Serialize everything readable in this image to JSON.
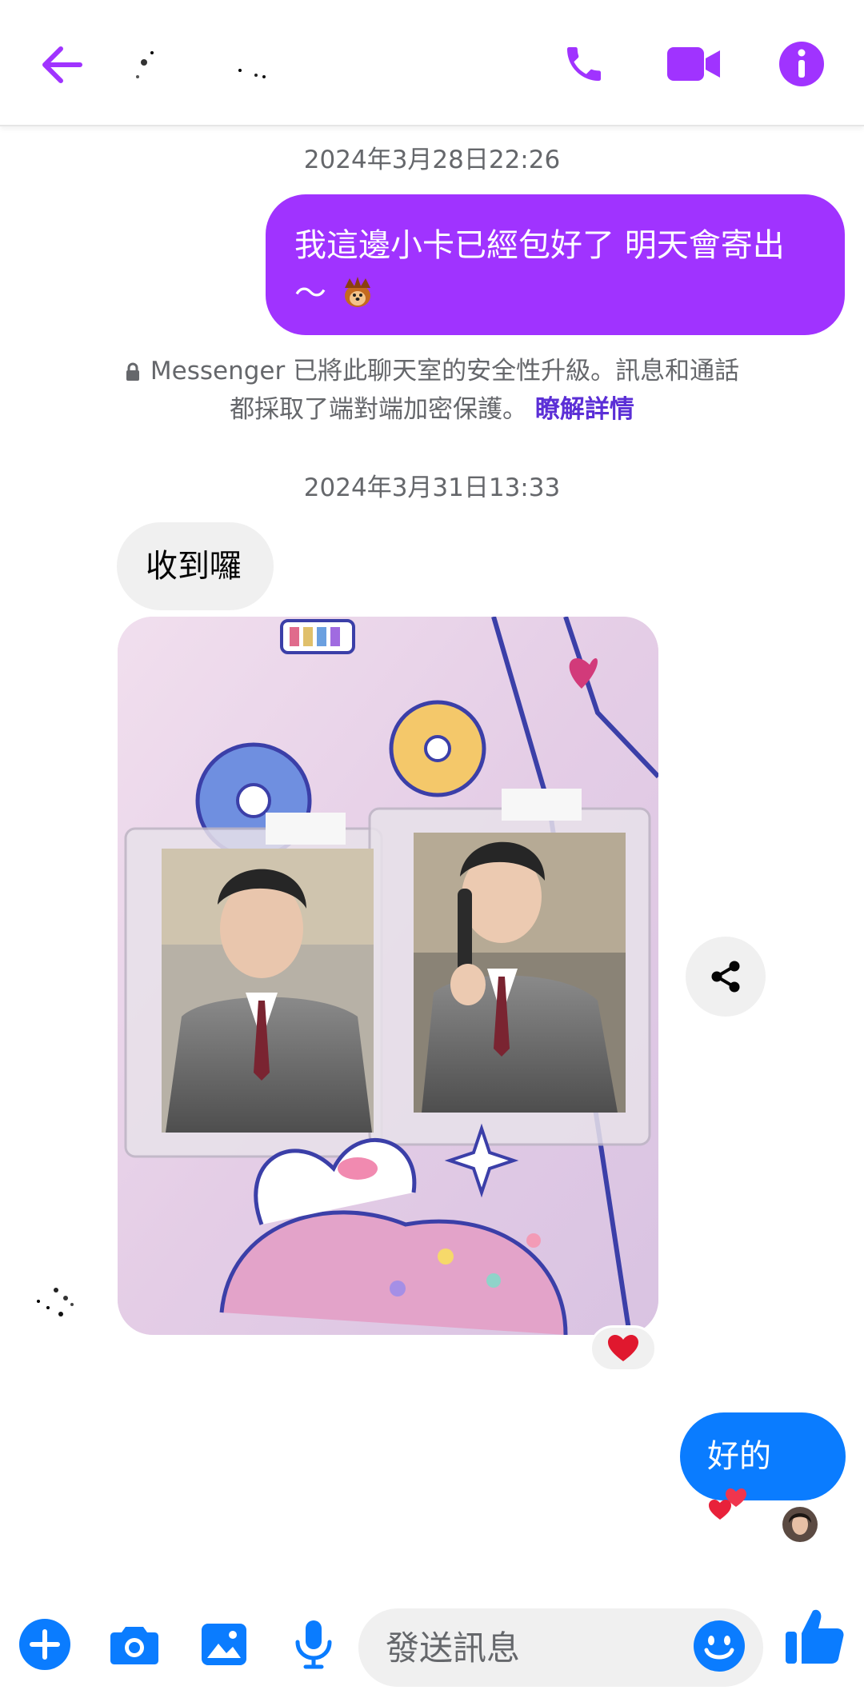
{
  "header": {
    "back_icon": "arrow-left-icon",
    "call_icon": "phone-icon",
    "video_icon": "video-camera-icon",
    "info_icon": "info-icon",
    "accent_color": "#a033ff"
  },
  "messages": {
    "timestamp_1": "2024年3月28日22:26",
    "outgoing_1": "我這邊小卡已經包好了 明天會寄出～",
    "system_notice": "Messenger 已將此聊天室的安全性升級。訊息和通話都採取了端對端加密保護。",
    "system_link": "瞭解詳情",
    "timestamp_2": "2024年3月31日13:33",
    "incoming_1": "收到囉",
    "photo_reaction": "❤️",
    "outgoing_2": "好的"
  },
  "composer": {
    "placeholder": "發送訊息",
    "icons": [
      "plus-icon",
      "camera-icon",
      "image-icon",
      "microphone-icon",
      "emoji-icon",
      "thumbs-up-icon"
    ],
    "color": "#0a7cff"
  }
}
